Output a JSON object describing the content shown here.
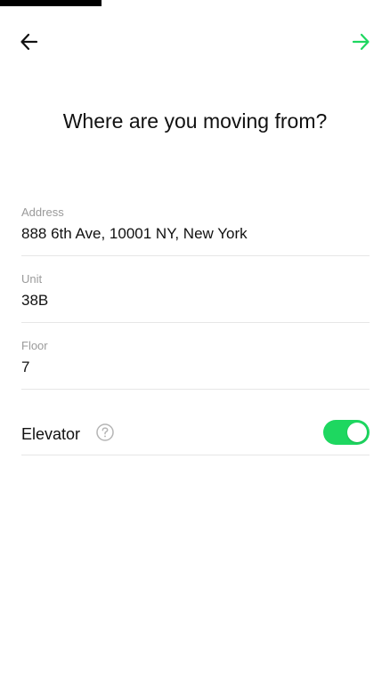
{
  "progress": {
    "fraction": 0.26
  },
  "header": {
    "back_icon": "arrow-left-icon",
    "next_icon": "arrow-right-icon",
    "accent_color": "#1ed760"
  },
  "page": {
    "title": "Where are you moving from?"
  },
  "form": {
    "address": {
      "label": "Address",
      "value": "888 6th Ave, 10001 NY, New York"
    },
    "unit": {
      "label": "Unit",
      "value": "38B"
    },
    "floor": {
      "label": "Floor",
      "value": "7"
    },
    "elevator": {
      "label": "Elevator",
      "help_icon": "question-circle-icon",
      "enabled": true
    }
  }
}
